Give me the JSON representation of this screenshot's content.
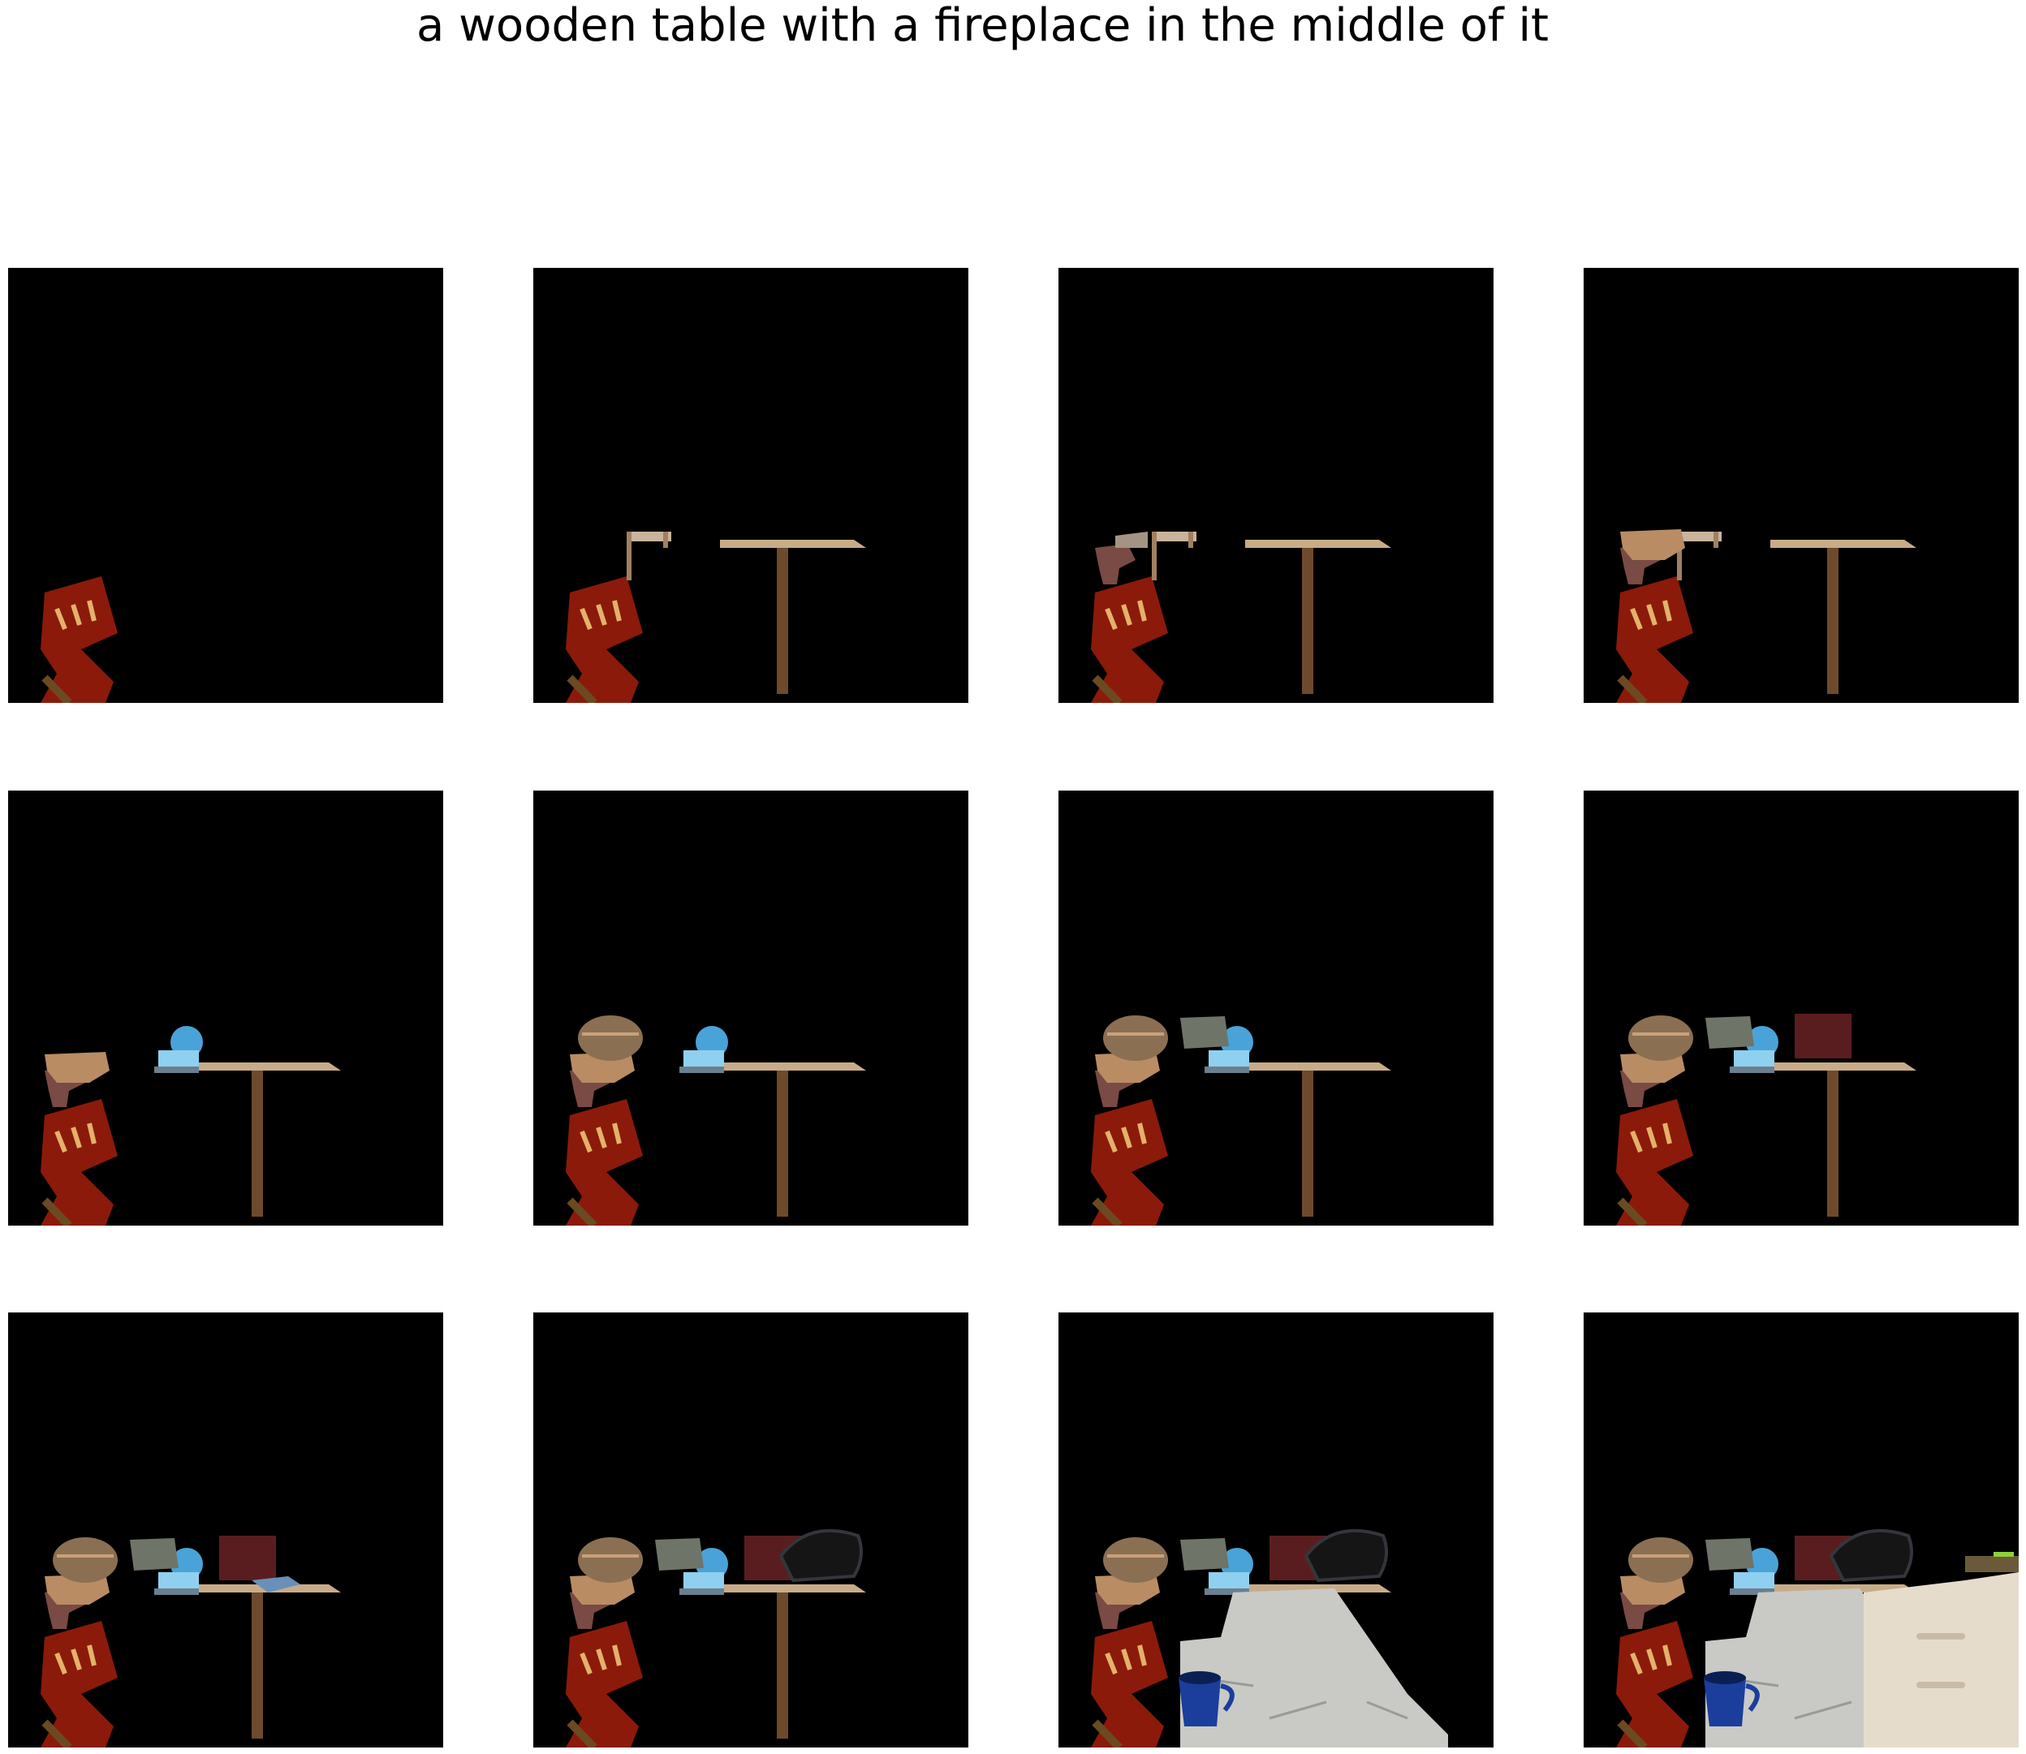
{
  "title": "a wooden table with a fireplace in the middle of it",
  "grid": {
    "rows": 3,
    "cols": 4
  },
  "panels": [
    {
      "step": 1,
      "objects": [
        "red-chair"
      ]
    },
    {
      "step": 2,
      "objects": [
        "red-chair",
        "small-shelf",
        "table"
      ]
    },
    {
      "step": 3,
      "objects": [
        "red-chair",
        "small-shelf",
        "table",
        "armchair"
      ]
    },
    {
      "step": 4,
      "objects": [
        "red-chair",
        "small-shelf",
        "table",
        "armchair",
        "fabric-piece"
      ]
    },
    {
      "step": 5,
      "objects": [
        "red-chair",
        "table",
        "armchair",
        "fabric-piece",
        "blue-toy"
      ]
    },
    {
      "step": 6,
      "objects": [
        "red-chair",
        "table",
        "armchair",
        "fabric-piece",
        "blue-toy",
        "basket"
      ]
    },
    {
      "step": 7,
      "objects": [
        "red-chair",
        "table",
        "armchair",
        "fabric-piece",
        "blue-toy",
        "basket",
        "grey-box"
      ]
    },
    {
      "step": 8,
      "objects": [
        "red-chair",
        "table",
        "armchair",
        "fabric-piece",
        "blue-toy",
        "basket",
        "grey-box",
        "red-cushion"
      ]
    },
    {
      "step": 9,
      "objects": [
        "red-chair",
        "table",
        "armchair",
        "fabric-piece",
        "blue-toy",
        "basket",
        "grey-box",
        "red-cushion",
        "blue-dish"
      ]
    },
    {
      "step": 10,
      "objects": [
        "red-chair",
        "table",
        "armchair",
        "fabric-piece",
        "blue-toy",
        "basket",
        "grey-box",
        "red-cushion",
        "black-pot"
      ]
    },
    {
      "step": 11,
      "objects": [
        "red-chair",
        "table",
        "armchair",
        "fabric-piece",
        "blue-toy",
        "basket",
        "grey-box",
        "red-cushion",
        "black-pot",
        "floor",
        "blue-bucket"
      ]
    },
    {
      "step": 12,
      "objects": [
        "red-chair",
        "table",
        "armchair",
        "fabric-piece",
        "blue-toy",
        "basket",
        "grey-box",
        "red-cushion",
        "black-pot",
        "floor",
        "blue-bucket",
        "white-cabinet"
      ]
    }
  ]
}
